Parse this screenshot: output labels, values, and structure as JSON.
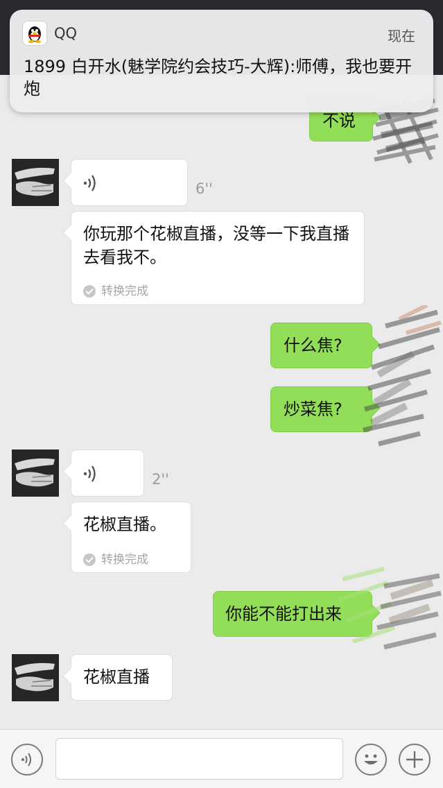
{
  "notification": {
    "app_name": "QQ",
    "time": "现在",
    "message": "1899  白开水(魅学院约会技巧-大辉):师傅，我也要开炮"
  },
  "messages": [
    {
      "side": "right",
      "type": "text",
      "text": "不说"
    },
    {
      "side": "left",
      "type": "voice",
      "duration": "6''",
      "transcript": "你玩那个花椒直播，没等一下我直播去看我不。",
      "status": "转换完成"
    },
    {
      "side": "right",
      "type": "text",
      "text": "什么焦?"
    },
    {
      "side": "right",
      "type": "text",
      "text": "炒菜焦?"
    },
    {
      "side": "left",
      "type": "voice",
      "duration": "2''",
      "transcript": "花椒直播。",
      "status": "转换完成"
    },
    {
      "side": "right",
      "type": "text",
      "text": "你能不能打出来"
    },
    {
      "side": "left",
      "type": "text",
      "text": "花椒直播"
    }
  ],
  "colors": {
    "own_bubble": "#93de59",
    "other_bubble": "#ffffff",
    "background": "#ebebeb"
  },
  "input_bar": {
    "voice_button_icon": "voice-icon",
    "emoji_button_icon": "emoji-icon",
    "more_button_icon": "plus-icon"
  }
}
